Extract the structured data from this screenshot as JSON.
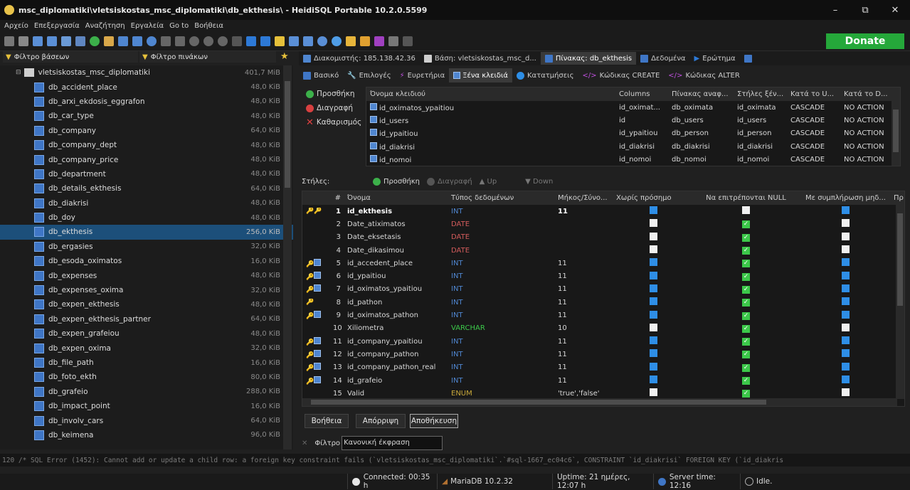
{
  "window": {
    "title": "msc_diplomatiki\\vletsiskostas_msc_diplomatiki\\db_ekthesis\\ - HeidiSQL Portable 10.2.0.5599",
    "controls": [
      "–",
      "⧉",
      "✕"
    ]
  },
  "menu": [
    "Αρχείο",
    "Επεξεργασία",
    "Αναζήτηση",
    "Εργαλεία",
    "Go to",
    "Βοήθεια"
  ],
  "toolbar": {
    "donate_label": "Donate"
  },
  "filters": {
    "db_filter": "Φίλτρο βάσεων",
    "table_filter": "Φίλτρο πινάκων"
  },
  "top_tabs": [
    {
      "label": "Διακομιστής: 185.138.42.36",
      "icon": "server-icon",
      "active": false
    },
    {
      "label": "Βάση: vletsiskostas_msc_d...",
      "icon": "database-icon",
      "active": false
    },
    {
      "label": "Πίνακας: db_ekthesis",
      "icon": "table-icon",
      "active": true
    },
    {
      "label": "Δεδομένα",
      "icon": "grid-icon",
      "active": false
    },
    {
      "label": "Ερώτημα",
      "icon": "play-icon",
      "active": false
    }
  ],
  "tree": {
    "root": {
      "label": "vletsiskostas_msc_diplomatiki",
      "size": "401,7 MiB"
    },
    "items": [
      {
        "name": "db_accident_place",
        "size": "48,0 KiB"
      },
      {
        "name": "db_arxi_ekdosis_eggrafon",
        "size": "48,0 KiB"
      },
      {
        "name": "db_car_type",
        "size": "48,0 KiB"
      },
      {
        "name": "db_company",
        "size": "64,0 KiB"
      },
      {
        "name": "db_company_dept",
        "size": "48,0 KiB"
      },
      {
        "name": "db_company_price",
        "size": "48,0 KiB"
      },
      {
        "name": "db_department",
        "size": "48,0 KiB"
      },
      {
        "name": "db_details_ekthesis",
        "size": "64,0 KiB"
      },
      {
        "name": "db_diakrisi",
        "size": "48,0 KiB"
      },
      {
        "name": "db_doy",
        "size": "48,0 KiB"
      },
      {
        "name": "db_ekthesis",
        "size": "256,0 KiB",
        "selected": true
      },
      {
        "name": "db_ergasies",
        "size": "32,0 KiB"
      },
      {
        "name": "db_esoda_oximatos",
        "size": "16,0 KiB"
      },
      {
        "name": "db_expenses",
        "size": "48,0 KiB"
      },
      {
        "name": "db_expenses_oxima",
        "size": "32,0 KiB"
      },
      {
        "name": "db_expen_ekthesis",
        "size": "48,0 KiB"
      },
      {
        "name": "db_expen_ekthesis_partner",
        "size": "64,0 KiB"
      },
      {
        "name": "db_expen_grafeiou",
        "size": "48,0 KiB"
      },
      {
        "name": "db_expen_oxima",
        "size": "32,0 KiB"
      },
      {
        "name": "db_file_path",
        "size": "16,0 KiB"
      },
      {
        "name": "db_foto_ekth",
        "size": "80,0 KiB"
      },
      {
        "name": "db_grafeio",
        "size": "288,0 KiB"
      },
      {
        "name": "db_impact_point",
        "size": "16,0 KiB"
      },
      {
        "name": "db_involv_cars",
        "size": "64,0 KiB"
      },
      {
        "name": "db_keimena",
        "size": "96,0 KiB"
      }
    ]
  },
  "sub_tabs": [
    "Βασικό",
    "Επιλογές",
    "Ευρετήρια",
    "Ξένα κλειδιά",
    "Κατατμήσεις",
    "Κώδικας CREATE",
    "Κώδικας ALTER"
  ],
  "fk_actions": {
    "add": "Προσθήκη",
    "delete": "Διαγραφή",
    "clear": "Καθαρισμός"
  },
  "fk_table": {
    "headers": [
      "Όνομα κλειδιού",
      "Columns",
      "Πίνακας αναφ...",
      "Στήλες ξέν...",
      "Κατά το U...",
      "Κατά το D..."
    ],
    "rows": [
      [
        "id_oximatos_ypaitiou",
        "id_oximat...",
        "db_oximata",
        "id_oximata",
        "CASCADE",
        "NO ACTION"
      ],
      [
        "id_users",
        "id",
        "db_users",
        "id_users",
        "CASCADE",
        "NO ACTION"
      ],
      [
        "id_ypaitiou",
        "id_ypaitiou",
        "db_person",
        "id_person",
        "CASCADE",
        "NO ACTION"
      ],
      [
        "id_diakrisi",
        "id_diakrisi",
        "db_diakrisi",
        "id_diakrisi",
        "CASCADE",
        "NO ACTION"
      ],
      [
        "id_nomoi",
        "id_nomoi",
        "db_nomoi",
        "id_nomoi",
        "CASCADE",
        "NO ACTION"
      ]
    ]
  },
  "columns_bar": {
    "label": "Στήλες:",
    "add": "Προσθήκη",
    "delete": "Διαγραφή",
    "up": "Up",
    "down": "Down"
  },
  "columns_table": {
    "headers": [
      "#",
      "Όνομα",
      "Τύπος δεδομένων",
      "Μήκος/Σύνο...",
      "Χωρίς πρόσημο",
      "Να επιτρέπονται NULL",
      "Με συμπλήρωση μηδ...",
      "Πρ"
    ],
    "rows": [
      {
        "num": "1",
        "name": "id_ekthesis",
        "type": "INT",
        "len": "11",
        "unsigned": "blue",
        "nullable": "white",
        "zerofill": "blue",
        "keys": "pk"
      },
      {
        "num": "2",
        "name": "Date_atiximatos",
        "type": "DATE",
        "len": "",
        "unsigned": "white",
        "nullable": "green",
        "zerofill": "white",
        "keys": ""
      },
      {
        "num": "3",
        "name": "Date_eksetasis",
        "type": "DATE",
        "len": "",
        "unsigned": "white",
        "nullable": "green",
        "zerofill": "white",
        "keys": ""
      },
      {
        "num": "4",
        "name": "Date_dikasimou",
        "type": "DATE",
        "len": "",
        "unsigned": "white",
        "nullable": "green",
        "zerofill": "white",
        "keys": ""
      },
      {
        "num": "5",
        "name": "id_accedent_place",
        "type": "INT",
        "len": "11",
        "unsigned": "blue",
        "nullable": "green",
        "zerofill": "blue",
        "keys": "fk"
      },
      {
        "num": "6",
        "name": "id_ypaitiou",
        "type": "INT",
        "len": "11",
        "unsigned": "blue",
        "nullable": "green",
        "zerofill": "blue",
        "keys": "fk"
      },
      {
        "num": "7",
        "name": "id_oximatos_ypaitiou",
        "type": "INT",
        "len": "11",
        "unsigned": "blue",
        "nullable": "green",
        "zerofill": "blue",
        "keys": "fk"
      },
      {
        "num": "8",
        "name": "id_pathon",
        "type": "INT",
        "len": "11",
        "unsigned": "blue",
        "nullable": "green",
        "zerofill": "blue",
        "keys": "k"
      },
      {
        "num": "9",
        "name": "id_oximatos_pathon",
        "type": "INT",
        "len": "11",
        "unsigned": "blue",
        "nullable": "green",
        "zerofill": "blue",
        "keys": "fk"
      },
      {
        "num": "10",
        "name": "Xiliometra",
        "type": "VARCHAR",
        "len": "10",
        "unsigned": "white",
        "nullable": "green",
        "zerofill": "white",
        "keys": ""
      },
      {
        "num": "11",
        "name": "id_company_ypaitiou",
        "type": "INT",
        "len": "11",
        "unsigned": "blue",
        "nullable": "green",
        "zerofill": "blue",
        "keys": "fk"
      },
      {
        "num": "12",
        "name": "id_company_pathon",
        "type": "INT",
        "len": "11",
        "unsigned": "blue",
        "nullable": "green",
        "zerofill": "blue",
        "keys": "fk"
      },
      {
        "num": "13",
        "name": "id_company_pathon_real",
        "type": "INT",
        "len": "11",
        "unsigned": "blue",
        "nullable": "green",
        "zerofill": "blue",
        "keys": "fk"
      },
      {
        "num": "14",
        "name": "id_grafeio",
        "type": "INT",
        "len": "11",
        "unsigned": "blue",
        "nullable": "green",
        "zerofill": "blue",
        "keys": "fk"
      },
      {
        "num": "15",
        "name": "Valid",
        "type": "ENUM",
        "len": "'true','false'",
        "unsigned": "white",
        "nullable": "green",
        "zerofill": "white",
        "keys": ""
      }
    ]
  },
  "bottom_buttons": {
    "help": "Βοήθεια",
    "discard": "Απόρριψη",
    "save": "Αποθήκευση"
  },
  "filter_row": {
    "label": "Φίλτρο",
    "value": "Κανονική έκφραση"
  },
  "sql_log": "120 /* SQL Error (1452): Cannot add or update a child row: a foreign key constraint fails (`vletsiskostas_msc_diplomatiki`.`#sql-1667_ec04c6`, CONSTRAINT `id_diakrisi` FOREIGN KEY (`id_diakris",
  "status": {
    "connected": "Connected: 00:35 h",
    "server": "MariaDB 10.2.32",
    "uptime": "Uptime: 21 ημέρες, 12:07 h",
    "server_time": "Server time: 12:16",
    "state": "Idle."
  },
  "colors": {
    "accent": "#1c4f7a",
    "donate": "#25a83a",
    "date_type": "#d05a5a",
    "int_type": "#4f86d0",
    "varchar_type": "#3cc84a"
  }
}
